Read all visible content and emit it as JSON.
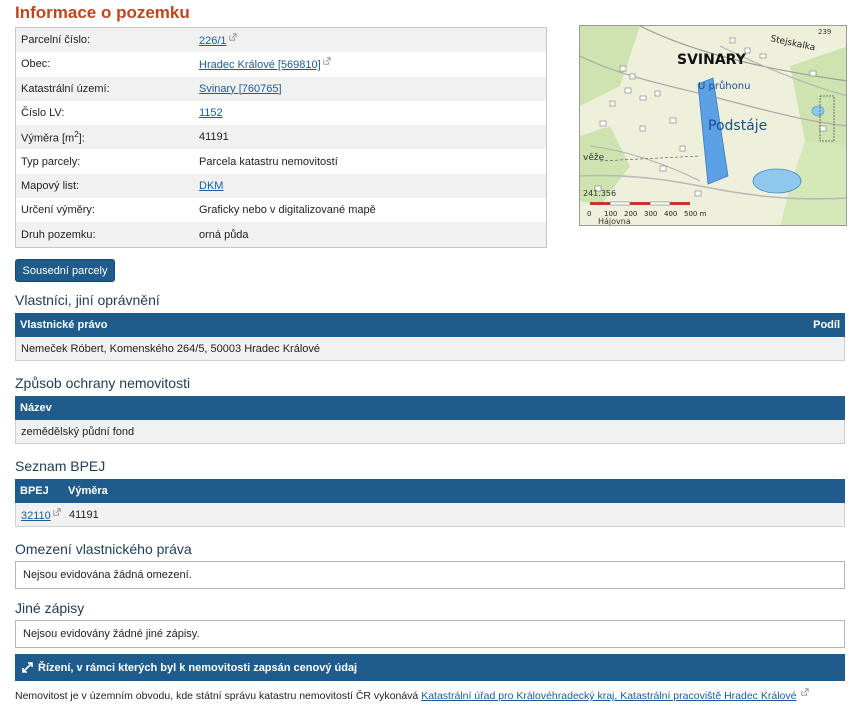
{
  "page_title": "Informace o pozemku",
  "info": {
    "parcel_number": {
      "label": "Parcelní číslo:",
      "value": "226/1"
    },
    "municipality": {
      "label": "Obec:",
      "value": "Hradec Králové [569810]"
    },
    "cadastral_area": {
      "label": "Katastrální území:",
      "value": "Svinary [760765]"
    },
    "lv_number": {
      "label": "Číslo LV:",
      "value": "1152"
    },
    "area": {
      "label_prefix": "Výměra [m",
      "label_sup": "2",
      "label_suffix": "]:",
      "value": "41191"
    },
    "parcel_type": {
      "label": "Typ parcely:",
      "value": "Parcela katastru nemovitostí"
    },
    "map_sheet": {
      "label": "Mapový list:",
      "value": "DKM"
    },
    "area_determination": {
      "label": "Určení výměry:",
      "value": "Graficky nebo v digitalizované mapě"
    },
    "land_type": {
      "label": "Druh pozemku:",
      "value": "orná půda"
    }
  },
  "map": {
    "labels": {
      "town": "SVINARY",
      "u_pruhonu": "U průhonu",
      "podstaje": "Podstáje",
      "stejskalka": "Stejskalka",
      "veze": "věže",
      "hajovna": "Hájovna",
      "elev": "241.356",
      "num239": "239"
    },
    "scale_labels": [
      "0",
      "100",
      "200",
      "300",
      "400",
      "500 m"
    ]
  },
  "buttons": {
    "neighbors": "Sousední parcely"
  },
  "owners": {
    "title": "Vlastníci, jiní oprávnění",
    "col_right": "Vlastnické právo",
    "col_share": "Podíl",
    "row": "Nemeček Róbert, Komenského 264/5, 50003 Hradec Králové"
  },
  "protection": {
    "title": "Způsob ochrany nemovitosti",
    "col_name": "Název",
    "row": "zemědělský půdní fond"
  },
  "bpej": {
    "title": "Seznam BPEJ",
    "col_bpej": "BPEJ",
    "col_area": "Výměra",
    "code": "32110",
    "area": "41191"
  },
  "restrictions": {
    "title": "Omezení vlastnického práva",
    "text": "Nejsou evidována žádná omezení."
  },
  "other": {
    "title": "Jiné zápisy",
    "text": "Nejsou evidovány žádné jiné zápisy."
  },
  "price_bar": "Řízení, v rámci kterých byl k nemovitosti zapsán cenový údaj",
  "footer": {
    "text": "Nemovitost je v územním obvodu, kde státní správu katastru nemovitostí ČR vykonává",
    "link": "Katastrální úřad pro Královéhradecký kraj, Katastrální pracoviště Hradec Králové"
  },
  "colors": {
    "title": "#c1441e",
    "header_bar": "#1f5c8c",
    "section_title": "#1e3c58",
    "link": "#1a5c9e"
  }
}
